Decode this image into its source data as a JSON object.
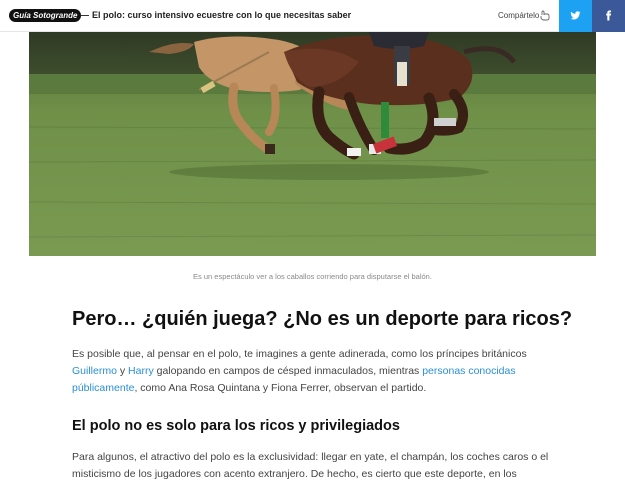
{
  "topbar": {
    "logo_text": "Guía Sotogrande",
    "dash": "—",
    "article_title": "El polo: curso intensivo ecuestre con lo que necesitas saber",
    "share_label": "Compártelo",
    "share_icon": "share-pointer-icon",
    "twitter_icon": "twitter-icon",
    "facebook_icon": "facebook-icon",
    "twitter_color": "#1da1f2",
    "facebook_color": "#3b5998"
  },
  "hero": {
    "caption": "Es un espectáculo ver a los caballos corriendo para disputarse el balón."
  },
  "section1": {
    "heading": "Pero… ¿quién juega? ¿No es un deporte para ricos?",
    "p_text_1": "Es posible que, al pensar en el polo, te imagines a gente adinerada, como los príncipes británicos",
    "link_guillermo": "Guillermo",
    "p_text_y": "y",
    "link_harry": "Harry",
    "p_text_2": "galopando en campos de césped inmaculados, mientras",
    "link_personas": "personas conocidas públicamente",
    "p_text_3": ", como Ana Rosa Quintana y Fiona Ferrer, observan el partido.",
    "link_color": "#2a8fd6"
  },
  "section2": {
    "heading": "El polo no es solo para los ricos y privilegiados",
    "p_text": "Para algunos, el atractivo del polo es la exclusividad: llegar en yate, el champán, los coches caros o el misticismo de los jugadores con acento extranjero. De hecho, es cierto que este deporte, en los"
  }
}
